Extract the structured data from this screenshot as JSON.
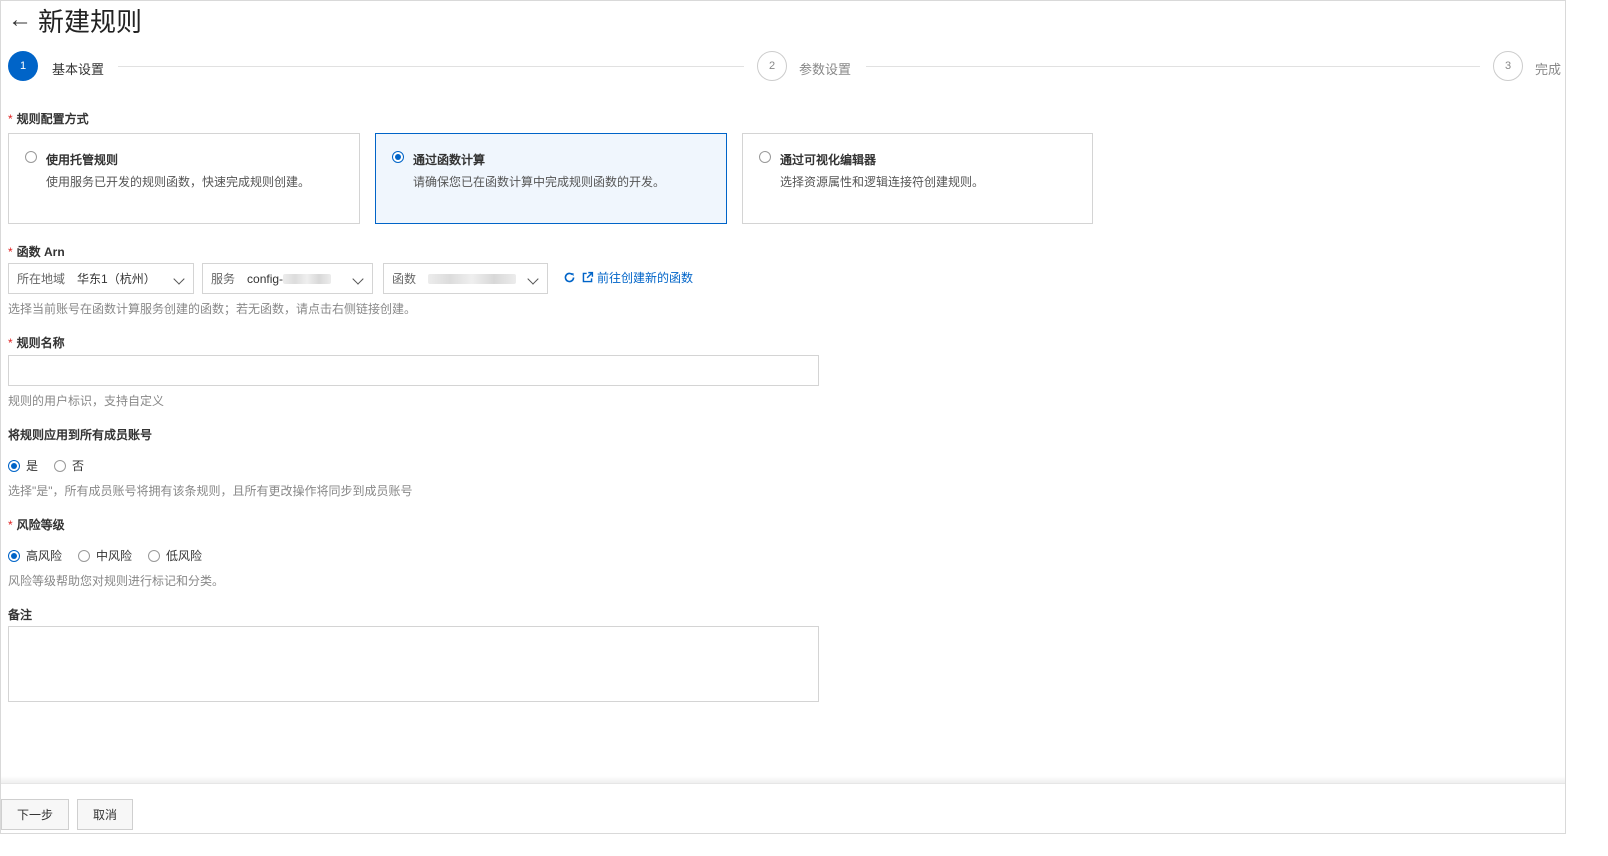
{
  "header": {
    "back_label": "←",
    "title": "新建规则"
  },
  "steps": [
    {
      "number": "1",
      "label": "基本设置",
      "state": "active"
    },
    {
      "number": "2",
      "label": "参数设置",
      "state": "inactive"
    },
    {
      "number": "3",
      "label": "完成",
      "state": "inactive"
    }
  ],
  "config_method": {
    "label": "规则配置方式",
    "required_mark": "*",
    "options": [
      {
        "title": "使用托管规则",
        "desc": "使用服务已开发的规则函数，快速完成规则创建。",
        "selected": false
      },
      {
        "title": "通过函数计算",
        "desc": "请确保您已在函数计算中完成规则函数的开发。",
        "selected": true
      },
      {
        "title": "通过可视化编辑器",
        "desc": "选择资源属性和逻辑连接符创建规则。",
        "selected": false
      }
    ]
  },
  "function_arn": {
    "label": "函数 Arn",
    "required_mark": "*",
    "region": {
      "label": "所在地域",
      "value": "华东1（杭州）"
    },
    "service": {
      "label": "服务",
      "value": "config-"
    },
    "function": {
      "label": "函数",
      "value": ""
    },
    "create_link": "前往创建新的函数",
    "help": "选择当前账号在函数计算服务创建的函数；若无函数，请点击右侧链接创建。"
  },
  "rule_name": {
    "label": "规则名称",
    "required_mark": "*",
    "value": "",
    "help": "规则的用户标识，支持自定义"
  },
  "apply_all": {
    "label": "将规则应用到所有成员账号",
    "options": [
      {
        "label": "是",
        "checked": true
      },
      {
        "label": "否",
        "checked": false
      }
    ],
    "help": "选择\"是\"，所有成员账号将拥有该条规则，且所有更改操作将同步到成员账号"
  },
  "risk_level": {
    "label": "风险等级",
    "required_mark": "*",
    "options": [
      {
        "label": "高风险",
        "checked": true
      },
      {
        "label": "中风险",
        "checked": false
      },
      {
        "label": "低风险",
        "checked": false
      }
    ],
    "help": "风险等级帮助您对规则进行标记和分类。"
  },
  "remarks": {
    "label": "备注",
    "value": ""
  },
  "footer": {
    "next_label": "下一步",
    "cancel_label": "取消"
  },
  "colors": {
    "primary": "#0064c8",
    "required": "#e02020",
    "border": "#d4d4d4",
    "selected_bg": "#f0f6fd"
  }
}
